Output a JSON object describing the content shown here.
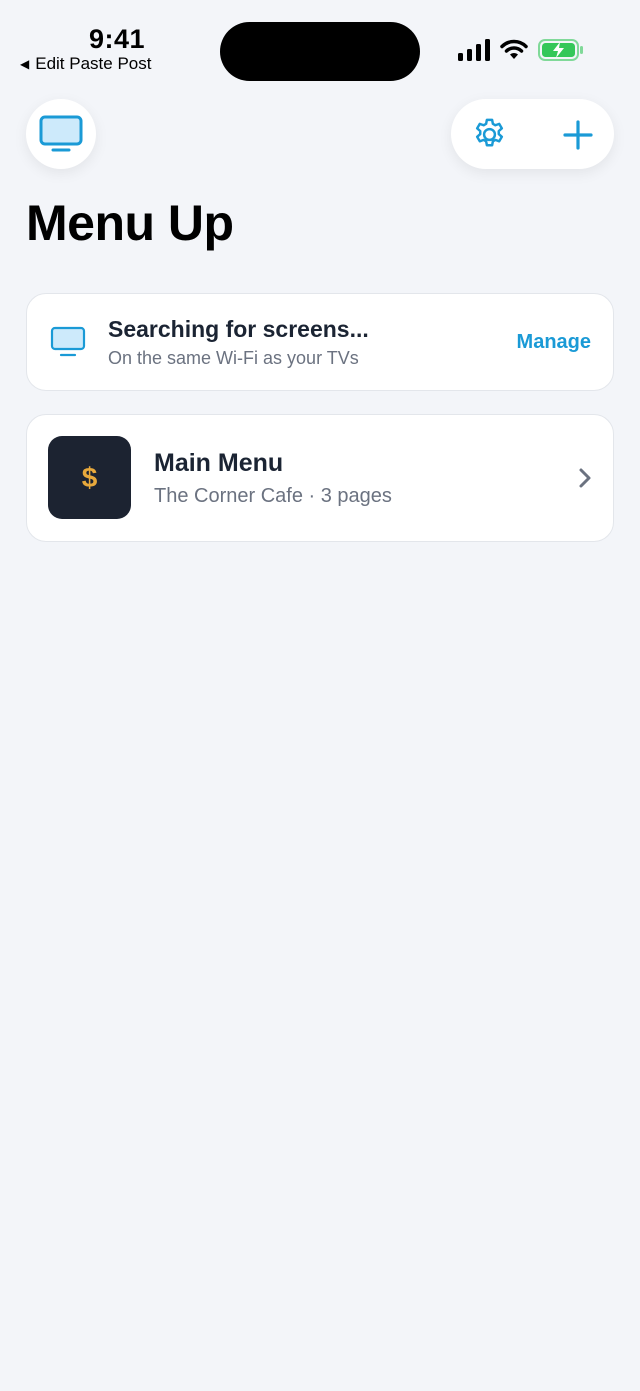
{
  "status_bar": {
    "time": "9:41",
    "back_app": "Edit Paste Post",
    "icons": [
      "signal-icon",
      "wifi-icon",
      "battery-charging-icon"
    ]
  },
  "header": {
    "left_icon": "tv-icon",
    "right_icons": [
      "gear-icon",
      "plus-icon"
    ],
    "title": "Menu Up"
  },
  "search_card": {
    "icon": "tv-icon",
    "title": "Searching for screens...",
    "subtitle": "On the same Wi-Fi as your TVs",
    "action_label": "Manage"
  },
  "menus": [
    {
      "thumb_symbol": "$",
      "title": "Main Menu",
      "subtitle": "The Corner Cafe · 3 pages"
    }
  ],
  "colors": {
    "background": "#f3f5f9",
    "accent": "#1a9ad6",
    "thumb_bg": "#1c2331",
    "thumb_symbol": "#e8a93c",
    "battery_green": "#34c759"
  }
}
